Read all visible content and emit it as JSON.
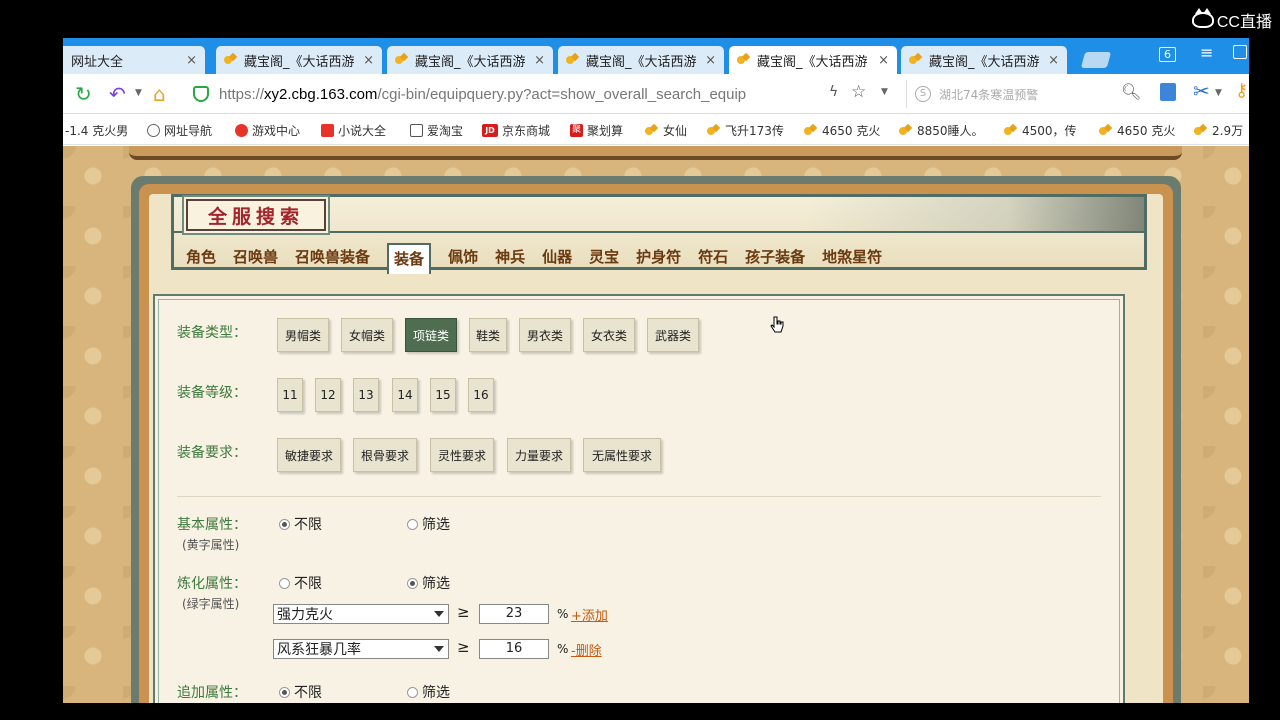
{
  "overlay": {
    "logo_text": "CC直播"
  },
  "browser": {
    "tabs": [
      {
        "title": "网址大全",
        "close": "×"
      },
      {
        "title": "藏宝阁_《大话西游",
        "close": "×"
      },
      {
        "title": "藏宝阁_《大话西游",
        "close": "×"
      },
      {
        "title": "藏宝阁_《大话西游",
        "close": "×"
      },
      {
        "title": "藏宝阁_《大话西游",
        "close": "×"
      },
      {
        "title": "藏宝阁_《大话西游",
        "close": "×"
      }
    ],
    "tab_count": "6",
    "url_scheme": "https://",
    "url_host": "xy2.cbg.163.com",
    "url_path": "/cgi-bin/equipquery.py?act=show_overall_search_equip",
    "search_placeholder": "湖北74条寒温预警",
    "bookmarks": [
      "-1.4 克火男",
      "网址导航",
      "游戏中心",
      "小说大全",
      "爱淘宝",
      "京东商城",
      "聚划算",
      "女仙",
      "飞升173传",
      "4650 克火",
      "8850睡人。",
      "4500，传",
      "4650 克火",
      "2.9万"
    ],
    "icons": {
      "reload": "reload-icon",
      "undo": "undo-icon",
      "home": "home-icon",
      "security": "shield-icon",
      "bolt": "bolt-icon",
      "star": "star-icon",
      "search": "search-icon",
      "extension": "extension-icon",
      "screenshot": "scissors-icon"
    }
  },
  "page": {
    "title": "全服搜索",
    "categories": [
      "角色",
      "召唤兽",
      "召唤兽装备",
      "装备",
      "佩饰",
      "神兵",
      "仙器",
      "灵宝",
      "护身符",
      "符石",
      "孩子装备",
      "地煞星符"
    ],
    "active_category": "装备",
    "equip_type": {
      "label": "装备类型：",
      "options": [
        "男帽类",
        "女帽类",
        "项链类",
        "鞋类",
        "男衣类",
        "女衣类",
        "武器类"
      ],
      "selected": "项链类"
    },
    "equip_level": {
      "label": "装备等级：",
      "options": [
        "11",
        "12",
        "13",
        "14",
        "15",
        "16"
      ]
    },
    "equip_requirement": {
      "label": "装备要求：",
      "options": [
        "敏捷要求",
        "根骨要求",
        "灵性要求",
        "力量要求",
        "无属性要求"
      ]
    },
    "basic_attr": {
      "label": "基本属性：",
      "sub": "(黄字属性)",
      "opt_unlimited": "不限",
      "opt_filter": "筛选",
      "selected": "不限"
    },
    "refine_attr": {
      "label": "炼化属性：",
      "sub": "(绿字属性)",
      "opt_unlimited": "不限",
      "opt_filter": "筛选",
      "selected": "筛选",
      "rows": [
        {
          "attribute": "强力克火",
          "op": "≥",
          "value": "23",
          "unit": "%",
          "action": "+添加"
        },
        {
          "attribute": "风系狂暴几率",
          "op": "≥",
          "value": "16",
          "unit": "%",
          "action": "-删除"
        }
      ]
    },
    "extra_attr": {
      "label": "追加属性：",
      "opt_unlimited": "不限",
      "opt_filter": "筛选",
      "selected": "不限"
    }
  }
}
